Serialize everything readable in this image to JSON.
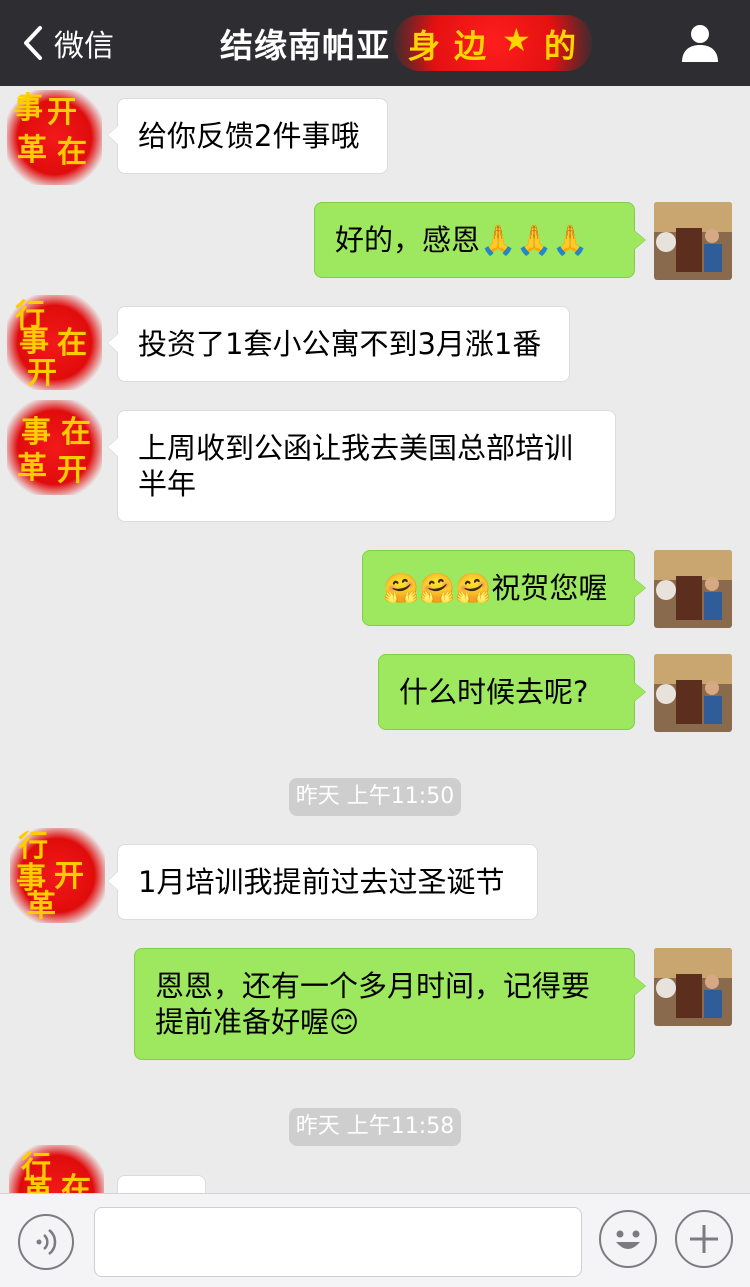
{
  "nav": {
    "back_label": "微信",
    "title": "结缘南帕亚",
    "redacted_chars": [
      "身",
      "边",
      "★",
      "的"
    ]
  },
  "seal_chars": [
    "事",
    "开",
    "在",
    "革",
    "行"
  ],
  "messages": [
    {
      "side": "in",
      "text": "给你反馈2件事哦"
    },
    {
      "side": "out",
      "text": "好的，感恩🙏🙏🙏"
    },
    {
      "side": "in",
      "text": "投资了1套小公寓不到3月涨1番"
    },
    {
      "side": "in",
      "text": "上周收到公函让我去美国总部培训半年"
    },
    {
      "side": "out",
      "text": "🤗🤗🤗祝贺您喔"
    },
    {
      "side": "out",
      "text": "什么时候去呢?"
    },
    {
      "side": "in",
      "text": "1月培训我提前过去过圣诞节"
    },
    {
      "side": "out",
      "text": "恩恩，还有一个多月时间，记得要提前准备好喔😊"
    }
  ],
  "timestamps": [
    "昨天 上午11:50",
    "昨天 上午11:58"
  ],
  "input": {
    "placeholder": ""
  },
  "icons": {
    "back": "chevron-left-icon",
    "profile": "person-icon",
    "voice": "voice-icon",
    "emoji": "emoji-icon",
    "plus": "plus-icon"
  },
  "colors": {
    "nav_bg": "#2e2e32",
    "chat_bg": "#ebebeb",
    "out_bubble": "#9ee85f",
    "in_bubble": "#ffffff"
  }
}
